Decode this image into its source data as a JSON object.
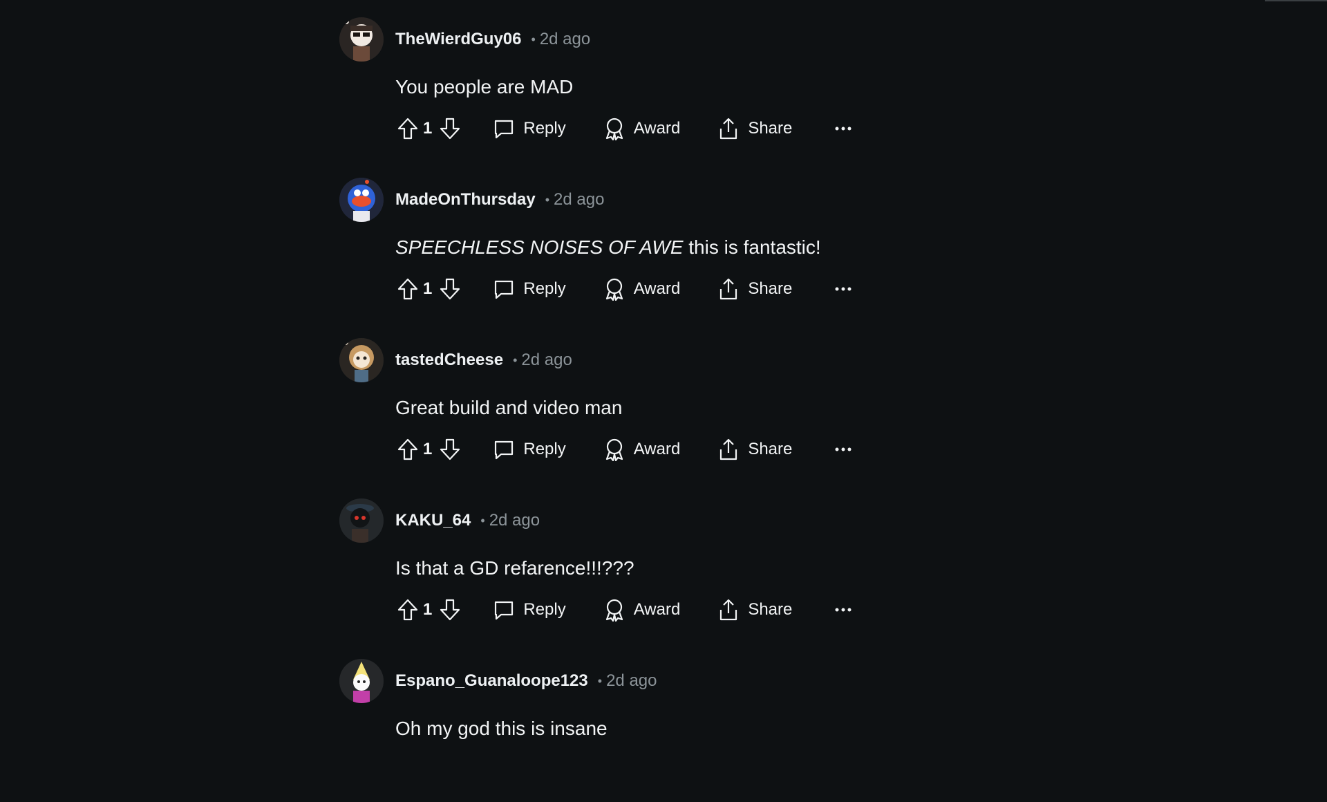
{
  "comments": [
    {
      "username": "TheWierdGuy06",
      "separator": "•",
      "timestamp": "2d ago",
      "body_em": "",
      "body": "You people are MAD",
      "score": "1",
      "reply_label": "Reply",
      "award_label": "Award",
      "share_label": "Share",
      "more_label": "···"
    },
    {
      "username": "MadeOnThursday",
      "separator": "•",
      "timestamp": "2d ago",
      "body_em": "SPEECHLESS NOISES OF AWE",
      "body": " this is fantastic!",
      "score": "1",
      "reply_label": "Reply",
      "award_label": "Award",
      "share_label": "Share",
      "more_label": "···"
    },
    {
      "username": "tastedCheese",
      "separator": "•",
      "timestamp": "2d ago",
      "body_em": "",
      "body": "Great build and video man",
      "score": "1",
      "reply_label": "Reply",
      "award_label": "Award",
      "share_label": "Share",
      "more_label": "···"
    },
    {
      "username": "KAKU_64",
      "separator": "•",
      "timestamp": "2d ago",
      "body_em": "",
      "body": "Is that a GD refarence!!!???",
      "score": "1",
      "reply_label": "Reply",
      "award_label": "Award",
      "share_label": "Share",
      "more_label": "···"
    },
    {
      "username": "Espano_Guanaloope123",
      "separator": "•",
      "timestamp": "2d ago",
      "body_em": "",
      "body": "Oh my god this is insane",
      "score": "",
      "reply_label": "",
      "award_label": "",
      "share_label": "",
      "more_label": ""
    }
  ],
  "colors": {
    "background": "#0e1113",
    "text": "#f2f4f5",
    "muted": "#8c9499"
  },
  "icons": [
    "upvote-icon",
    "downvote-icon",
    "reply-icon",
    "award-icon",
    "share-icon",
    "more-icon"
  ]
}
